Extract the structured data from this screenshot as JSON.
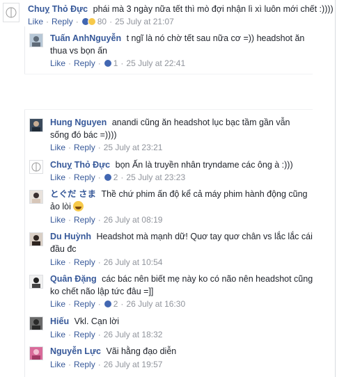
{
  "labels": {
    "like": "Like",
    "reply": "Reply"
  },
  "comments": [
    {
      "author": "Chuỵ Thỏ Đực",
      "text": "phái mà 3 ngày nữa tết thì mò đợi nhận lì xì luôn mới chết :))))",
      "reactions": "80",
      "time": "25 July at 21:07"
    },
    {
      "author": "Tuấn AnhNguyễn",
      "text": "t ngĩ là nó chờ tết sau nữa cơ =)) headshot ăn thua vs bọn ấn",
      "reactions": "1",
      "time": "25 July at 22:41"
    },
    {
      "author": "Hung Nguyen",
      "text": "anandi cũng ăn headshot lục bạc tầm gần vẫn sống đó bác =))))",
      "reactions": "",
      "time": "25 July at 23:21"
    },
    {
      "author": "Chuỵ Thỏ Đực",
      "text": "bọn Ấn là truyền nhân tryndame các ông à :)))",
      "reactions": "2",
      "time": "25 July at 23:23"
    },
    {
      "author": "とぐだ さま",
      "text": "Thề chứ phim ấn độ kể cả máy phim hành động cũng ảo lòi",
      "reactions": "",
      "time": "26 July at 08:19"
    },
    {
      "author": "Du Huỳnh",
      "text": "Headshot mà mạnh dữ! Quơ tay quơ chân vs lắc lắc cái đầu đc",
      "reactions": "",
      "time": "26 July at 10:54"
    },
    {
      "author": "Quân Đặng",
      "text": "các bác nên biết mẹ này ko có não nên headshot cũng ko chết não lập tức đâu =]]",
      "reactions": "2",
      "time": "26 July at 16:30"
    },
    {
      "author": "Hiếu",
      "text": "Vkl. Cạn lời",
      "reactions": "",
      "time": "26 July at 18:32"
    },
    {
      "author": "Nguyễn Lực",
      "text": "Vãi hằng đạo diễn",
      "reactions": "",
      "time": "26 July at 19:57"
    }
  ]
}
